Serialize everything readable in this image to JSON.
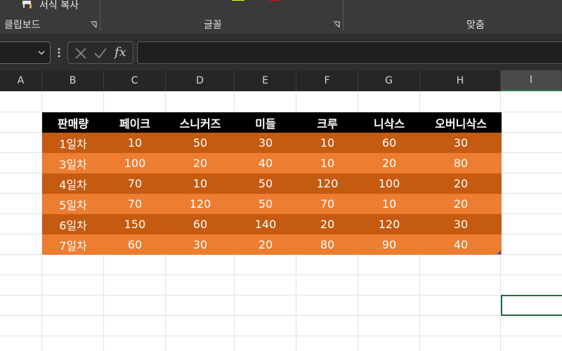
{
  "ribbon": {
    "format_copy_label": "서식 복사",
    "groups": {
      "clipboard": "클립보드",
      "font": "글꼴",
      "align": "맞춤"
    }
  },
  "formula_bar": {
    "name_box_value": "",
    "fx_label": "fx",
    "formula_value": ""
  },
  "columns": [
    "A",
    "B",
    "C",
    "D",
    "E",
    "F",
    "G",
    "H",
    "I"
  ],
  "selected_column": "I",
  "table": {
    "headers": [
      "판매량",
      "페이크",
      "스니커즈",
      "미들",
      "크루",
      "니삭스",
      "오버니삭스"
    ],
    "rows": [
      [
        "1일차",
        "10",
        "50",
        "30",
        "10",
        "60",
        "30"
      ],
      [
        "3일차",
        "100",
        "20",
        "40",
        "10",
        "20",
        "80"
      ],
      [
        "4일차",
        "70",
        "10",
        "50",
        "120",
        "100",
        "20"
      ],
      [
        "5일차",
        "70",
        "120",
        "50",
        "70",
        "10",
        "20"
      ],
      [
        "6일차",
        "150",
        "60",
        "140",
        "20",
        "120",
        "30"
      ],
      [
        "7일차",
        "60",
        "30",
        "20",
        "80",
        "90",
        "40"
      ]
    ]
  },
  "colors": {
    "header_bg": "#000000",
    "row_dark": "#c55a11",
    "row_light": "#ed7d31",
    "active_cell_border": "#1e6b41"
  }
}
